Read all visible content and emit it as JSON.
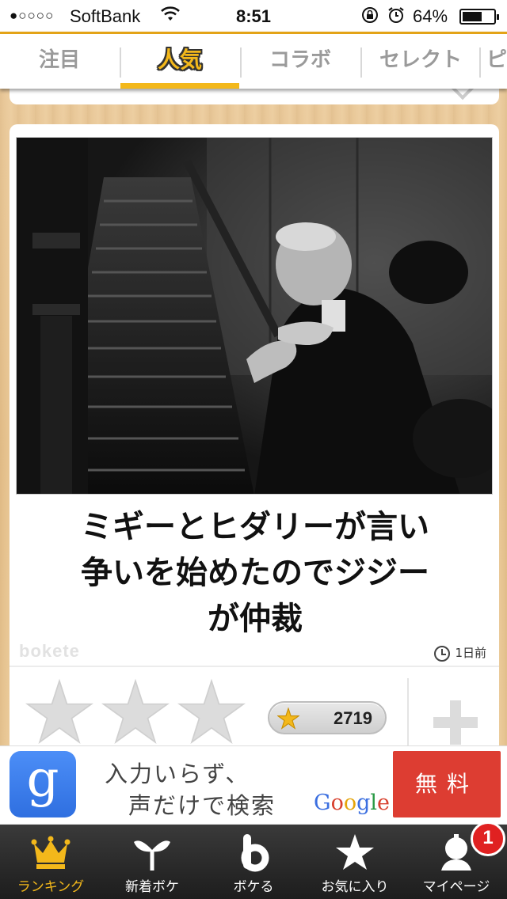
{
  "status_bar": {
    "signal": "●○○○○",
    "carrier": "SoftBank",
    "time": "8:51",
    "battery_percent": "64%",
    "battery_level": 0.64
  },
  "tabs": [
    {
      "label": "注目",
      "active": false
    },
    {
      "label": "人気",
      "active": true
    },
    {
      "label": "コラボ",
      "active": false
    },
    {
      "label": "セレクト",
      "active": false
    },
    {
      "label": "ピ",
      "active": false
    }
  ],
  "post": {
    "caption_lines": [
      "ミギーとヒダリーが言い",
      "争いを始めたのでジジー",
      "が仲裁"
    ],
    "logo_text": "bokete",
    "time_ago": "1日前",
    "score": "2719",
    "rating_stars": 3
  },
  "ad": {
    "logo_letter": "g",
    "line1": "入力いらず、",
    "line2": "声だけで検索",
    "google": "Google",
    "cta": "無料"
  },
  "bottom_nav": {
    "items": [
      {
        "label": "ランキング",
        "icon": "crown-icon",
        "active": true
      },
      {
        "label": "新着ボケ",
        "icon": "sprout-icon",
        "active": false
      },
      {
        "label": "ボケる",
        "icon": "bokete-b-icon",
        "active": false
      },
      {
        "label": "お気に入り",
        "icon": "star-icon",
        "active": false
      },
      {
        "label": "マイページ",
        "icon": "avatar-icon",
        "active": false
      }
    ],
    "badge_count": "1"
  },
  "colors": {
    "accent": "#f3b81b",
    "header_border": "#e3a317",
    "ad_cta": "#dd3d32"
  }
}
